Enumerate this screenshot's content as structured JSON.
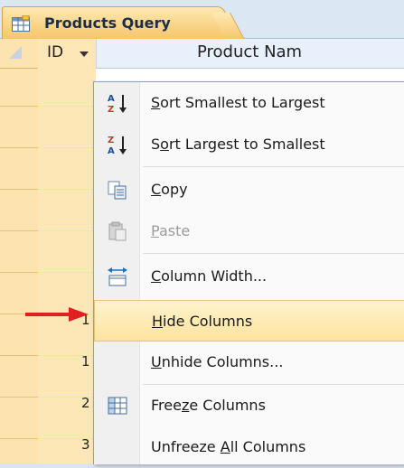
{
  "tab": {
    "label": "Products Query"
  },
  "grid": {
    "header": {
      "id_label": "ID",
      "product_label": "Product Nam"
    },
    "visible_ids": [
      "1",
      "1",
      "2",
      "3"
    ]
  },
  "menu": {
    "items": [
      {
        "pre": "",
        "acc": "S",
        "post": "ort Smallest to Largest",
        "icon": "sort-ascending-icon",
        "disabled": false
      },
      {
        "pre": "S",
        "acc": "o",
        "post": "rt Largest to Smallest",
        "icon": "sort-descending-icon",
        "disabled": false
      },
      {
        "pre": "",
        "acc": "C",
        "post": "opy",
        "icon": "copy-icon",
        "disabled": false
      },
      {
        "pre": "",
        "acc": "P",
        "post": "aste",
        "icon": "paste-icon",
        "disabled": true
      },
      {
        "pre": "",
        "acc": "C",
        "post": "olumn Width...",
        "icon": "column-width-icon",
        "disabled": false
      },
      {
        "pre": "",
        "acc": "H",
        "post": "ide Columns",
        "icon": "",
        "disabled": false,
        "highlighted": true
      },
      {
        "pre": "",
        "acc": "U",
        "post": "nhide Columns...",
        "icon": "",
        "disabled": false
      },
      {
        "pre": "Free",
        "acc": "z",
        "post": "e Columns",
        "icon": "freeze-columns-icon",
        "disabled": false
      },
      {
        "pre": "Unfreeze ",
        "acc": "A",
        "post": "ll Columns",
        "icon": "",
        "disabled": false
      }
    ]
  },
  "colors": {
    "highlight": "#fde39c",
    "arrow": "#e02020",
    "tab": "#f7c66a"
  }
}
